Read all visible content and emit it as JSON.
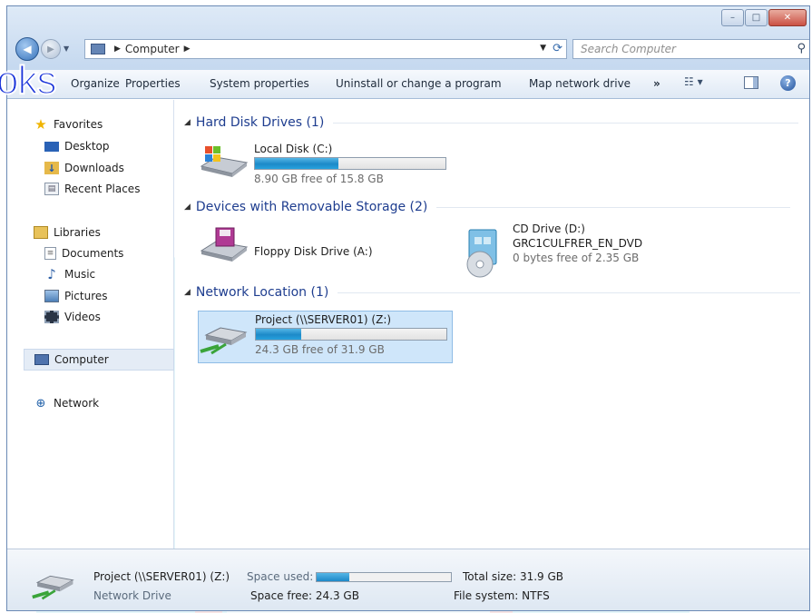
{
  "window": {
    "caption_buttons": [
      "minimize",
      "maximize",
      "close"
    ],
    "close_glyph": "✕",
    "min_glyph": "–",
    "max_glyph": "□"
  },
  "nav": {
    "back_glyph": "◀",
    "forward_glyph": "▶",
    "recent_glyph": "▼",
    "address_root": "Computer",
    "address_sep": "▶",
    "search_placeholder": "Search Computer"
  },
  "toolbar": {
    "organize_label": "Organize",
    "overlay_text": "oks",
    "properties": "Properties",
    "system_properties": "System properties",
    "uninstall": "Uninstall or change a program",
    "map_network": "Map network drive",
    "more": "»",
    "help": "?"
  },
  "sidebar": {
    "favorites": "Favorites",
    "desktop": "Desktop",
    "downloads": "Downloads",
    "recent_places": "Recent Places",
    "libraries": "Libraries",
    "documents": "Documents",
    "music": "Music",
    "pictures": "Pictures",
    "videos": "Videos",
    "computer": "Computer",
    "network": "Network"
  },
  "groups": {
    "hdd": "Hard Disk Drives (1)",
    "removable": "Devices with Removable Storage (2)",
    "network": "Network Location (1)"
  },
  "drives": {
    "c": {
      "name": "Local Disk (C:)",
      "free": "8.90 GB free of 15.8 GB",
      "used_fraction": 0.44
    },
    "a": {
      "name": "Floppy Disk Drive (A:)"
    },
    "d": {
      "name": "CD Drive (D:)",
      "label": "GRC1CULFRER_EN_DVD",
      "free": "0 bytes free of 2.35 GB"
    },
    "z": {
      "name": "Project (\\\\SERVER01) (Z:)",
      "free": "24.3 GB free of 31.9 GB",
      "used_fraction": 0.24
    }
  },
  "details": {
    "name": "Project (\\\\SERVER01) (Z:)",
    "type": "Network Drive",
    "space_used_label": "Space used:",
    "space_free": "Space free: 24.3 GB",
    "total_size": "Total size: 31.9 GB",
    "file_system": "File system: NTFS",
    "used_fraction": 0.24
  },
  "watermark": "Drop Books",
  "colors": {
    "accent": "#1e3d8f",
    "bar_fill": "#1d89c8",
    "selection": "#cfe6fa"
  }
}
